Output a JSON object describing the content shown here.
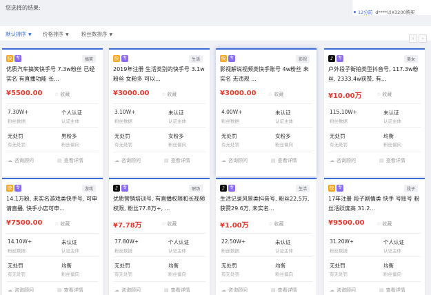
{
  "header": {
    "selected_label": "您选择的结果:"
  },
  "side": {
    "row_link": "12分前",
    "row_text": "d****以¥3200购买"
  },
  "sort": {
    "default": "默认排序",
    "price": "价格排序",
    "fans": "粉丝数排序",
    "caret": "▼",
    "prev": "‹",
    "next": "›"
  },
  "common": {
    "fans_label": "粉丝数据",
    "cert_label": "认证主体",
    "penalty_label": "有无处罚",
    "gender_label": "粉丝偏向",
    "fav": "收藏",
    "consult": "咨询顾问",
    "detail": "查看详情",
    "pro_badge": "专"
  },
  "cards": [
    {
      "platform": "ks",
      "platform_glyph": "快",
      "category": "搞笑",
      "title": "优质汽车搞笑快手号 7.3w粉丝 已经实名 有直播功能 长...",
      "price": "¥5500.00",
      "fans": "7.30W+",
      "cert": "个人认证",
      "penalty": "无处罚",
      "gender": "男粉多"
    },
    {
      "platform": "ks",
      "platform_glyph": "快",
      "category": "生活",
      "title": "2019年注册 生活类别的快手号 3.1w粉丝 女粉多 可以...",
      "price": "¥3000.00",
      "fans": "3.10W+",
      "cert": "未认证",
      "penalty": "无处罚",
      "gender": "女粉多"
    },
    {
      "platform": "ks",
      "platform_glyph": "快",
      "category": "影视",
      "title": "影视解说视频类快手账号 4w粉丝 未实名 无违规 ...",
      "price": "¥3000.00",
      "fans": "4.00W+",
      "cert": "未认证",
      "penalty": "无处罚",
      "gender": "女粉多"
    },
    {
      "platform": "dy",
      "platform_glyph": "♪",
      "category": "美女",
      "title": "户外段子街拍类型抖音号, 117.3w粉丝, 2333.4w获赞, 有...",
      "price": "¥10.00万",
      "fans": "115.10W+",
      "cert": "未认证",
      "penalty": "无处罚",
      "gender": "均衡"
    },
    {
      "platform": "ks",
      "platform_glyph": "快",
      "category": "游戏",
      "title": "14.1万粉, 未实名游戏类快手号, 可申请直播, 快手小店可申...",
      "price": "¥7500.00",
      "fans": "14.10W+",
      "cert": "未认证",
      "penalty": "无处罚",
      "gender": "均衡"
    },
    {
      "platform": "dy",
      "platform_glyph": "♪",
      "category": "职场",
      "title": "优质营销培训号, 有直播权限和长视频权限, 粉丝77.8万+, ...",
      "price": "¥7.78万",
      "fans": "77.80W+",
      "cert": "个人认证",
      "penalty": "无处罚",
      "gender": "均衡"
    },
    {
      "platform": "dy",
      "platform_glyph": "♪",
      "category": "生活",
      "title": "生活记录风景类抖音号, 粉丝22.5万, 获赞29.6万, 未实名...",
      "price": "¥1.00万",
      "fans": "22.50W+",
      "cert": "未认证",
      "penalty": "无处罚",
      "gender": "均衡"
    },
    {
      "platform": "ks",
      "platform_glyph": "快",
      "category": "段子",
      "title": "17年注册 段子剧情类 快手 号账号 粉丝活跃度高 31.2...",
      "price": "¥9500.00",
      "fans": "31.20W+",
      "cert": "个人认证",
      "penalty": "无处罚",
      "gender": "均衡"
    }
  ]
}
